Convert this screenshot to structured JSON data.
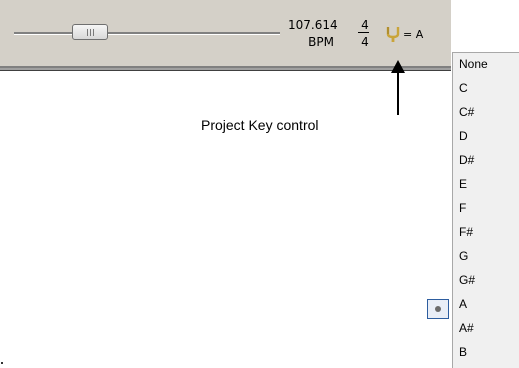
{
  "transport": {
    "tempo_value": "107.614",
    "tempo_unit": "BPM",
    "time_signature_numerator": "4",
    "time_signature_denominator": "4",
    "key_equals_label": "= A",
    "project_key_icon": "tuning-fork-icon"
  },
  "annotation": {
    "callout_text": "Project Key control"
  },
  "key_menu": {
    "items": [
      {
        "label": "None"
      },
      {
        "label": "C"
      },
      {
        "label": "C#"
      },
      {
        "label": "D"
      },
      {
        "label": "D#"
      },
      {
        "label": "E"
      },
      {
        "label": "F"
      },
      {
        "label": "F#"
      },
      {
        "label": "G"
      },
      {
        "label": "G#"
      },
      {
        "label": "A"
      },
      {
        "label": "A#"
      },
      {
        "label": "B"
      }
    ],
    "selected": "A"
  },
  "colors": {
    "toolbar_background": "#d4d0c8",
    "menu_background": "#f0f0f0",
    "selection_border": "#2d5d9f",
    "tuning_fork": "#c9a43a"
  }
}
